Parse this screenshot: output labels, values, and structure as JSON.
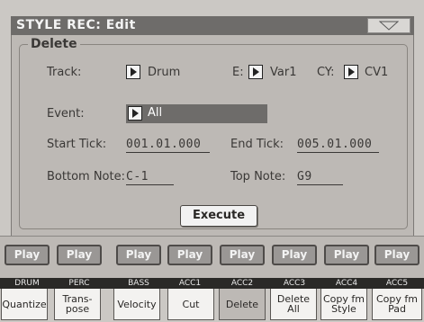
{
  "window": {
    "title": "STYLE REC: Edit"
  },
  "group": {
    "title": "Delete"
  },
  "fields": {
    "track_label": "Track:",
    "track_value": "Drum",
    "e_label": "E:",
    "e_value": "Var1",
    "cy_label": "CY:",
    "cy_value": "CV1",
    "event_label": "Event:",
    "event_value": "All",
    "start_label": "Start Tick:",
    "start_value": "001.01.000",
    "end_label": "End Tick:",
    "end_value": "005.01.000",
    "bottom_label": "Bottom Note:",
    "bottom_value": "C-1",
    "top_label": "Top Note:",
    "top_value": "G9"
  },
  "execute_label": "Execute",
  "play_label": "Play",
  "tracks": [
    "DRUM",
    "PERC",
    "BASS",
    "ACC1",
    "ACC2",
    "ACC3",
    "ACC4",
    "ACC5"
  ],
  "tabs": [
    {
      "label": "Quantize"
    },
    {
      "label": "Trans-\npose"
    },
    {
      "label": "Velocity"
    },
    {
      "label": "Cut"
    },
    {
      "label": "Delete"
    },
    {
      "label": "Delete\nAll"
    },
    {
      "label": "Copy fm\nStyle"
    },
    {
      "label": "Copy fm\nPad"
    }
  ],
  "active_tab": "Delete"
}
